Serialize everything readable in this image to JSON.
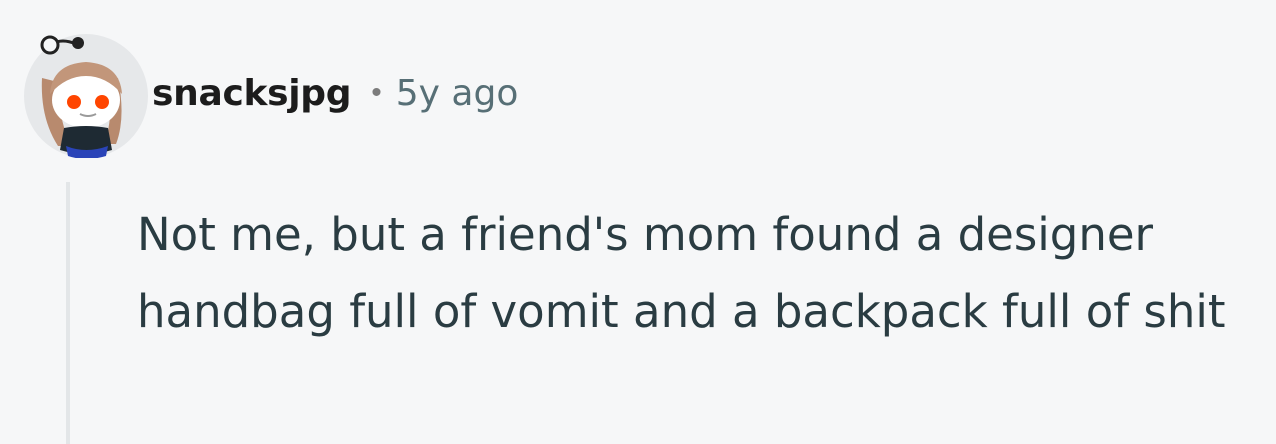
{
  "comment": {
    "author": "snacksjpg",
    "separator": "•",
    "timestamp": "5y ago",
    "body": "Not me, but a friend's mom found a designer handbag full of vomit and a backpack full of shit",
    "avatar_icon": "snoo-avatar-icon"
  },
  "colors": {
    "background": "#f6f7f8",
    "text": "#2a3c42",
    "meta": "#576f76",
    "thread_line": "#e3e6e8"
  }
}
